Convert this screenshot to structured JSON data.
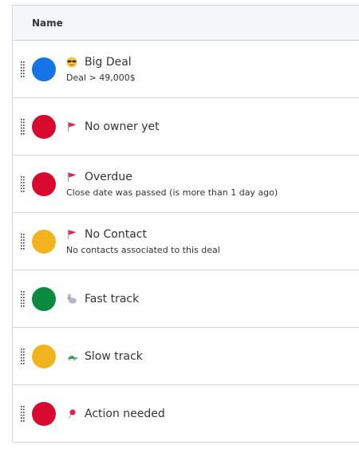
{
  "table": {
    "header": "Name",
    "rows": [
      {
        "title": "Big Deal",
        "subtitle": "Deal > 49,000$",
        "color": "#1473e6",
        "icon": "sunglasses-face-icon"
      },
      {
        "title": "No owner yet",
        "subtitle": "",
        "color": "#d9082f",
        "icon": "red-flag-icon"
      },
      {
        "title": "Overdue",
        "subtitle": "Close date was passed (is more than 1 day ago)",
        "color": "#d9082f",
        "icon": "red-flag-icon"
      },
      {
        "title": "No Contact",
        "subtitle": "No contacts associated to this deal",
        "color": "#f1b41f",
        "icon": "red-flag-icon"
      },
      {
        "title": "Fast track",
        "subtitle": "",
        "color": "#0a8a3e",
        "icon": "rabbit-icon"
      },
      {
        "title": "Slow track",
        "subtitle": "",
        "color": "#f1b41f",
        "icon": "turtle-icon"
      },
      {
        "title": "Action needed",
        "subtitle": "",
        "color": "#d9082f",
        "icon": "pushpin-icon"
      }
    ]
  }
}
